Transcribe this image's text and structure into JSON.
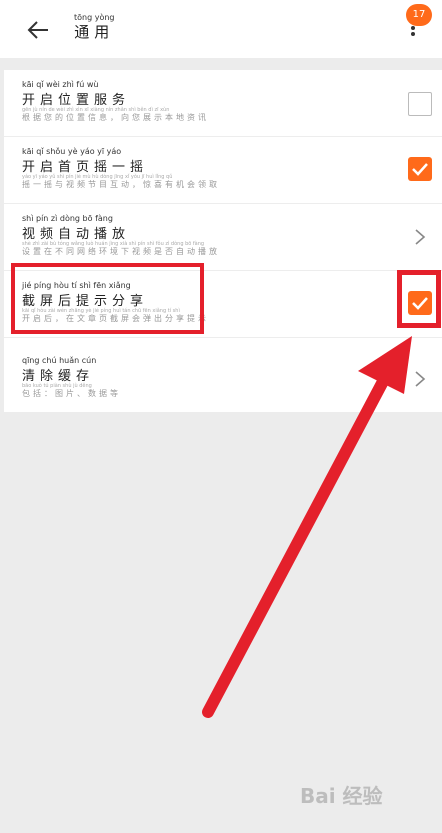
{
  "header": {
    "title": "通用",
    "title_pinyin": "tōng yòng",
    "badge": "17"
  },
  "rows": [
    {
      "title": "开启位置服务",
      "title_pinyin": "kāi qǐ wèi zhì fú wù",
      "subtitle": "根据您的位置信息，向您展示本地资讯",
      "subtitle_pinyin": "gēn jù nín de wèi zhì xìn xī xiàng nín zhǎn shì běn dì zī xùn",
      "control": "checkbox-unchecked"
    },
    {
      "title": "开启首页摇一摇",
      "title_pinyin": "kāi qǐ shǒu yè yáo yī yáo",
      "subtitle": "摇一摇与视频节目互动，惊喜有机会领取",
      "subtitle_pinyin": "yáo yī yáo yǔ shì pín jié mù hù dòng jīng xǐ yǒu jī huì lǐng qǔ",
      "control": "checkbox-checked"
    },
    {
      "title": "视频自动播放",
      "title_pinyin": "shì pín zì dòng bō fàng",
      "subtitle": "设置在不同网络环境下视频是否自动播放",
      "subtitle_pinyin": "shè zhì zài bù tóng wǎng luò huán jìng xià shì pín shì fǒu zì dòng bō fàng",
      "control": "chevron"
    },
    {
      "title": "截屏后提示分享",
      "title_pinyin": "jié píng hòu tí shì fēn xiǎng",
      "subtitle": "开启后，在文章页截屏会弹出分享提示",
      "subtitle_pinyin": "kāi qǐ hòu zài wén zhāng yè jié píng huì tán chū fēn xiǎng tí shì",
      "control": "checkbox-checked"
    },
    {
      "title": "清除缓存",
      "title_pinyin": "qīng chú huǎn cún",
      "subtitle": "包括：图片、数据等",
      "subtitle_pinyin": "bāo kuò tú piàn shù jù děng",
      "control": "chevron"
    }
  ],
  "watermark": "Bai 经验",
  "colors": {
    "accent": "#ff6a1a",
    "annotation": "#e4202b"
  }
}
